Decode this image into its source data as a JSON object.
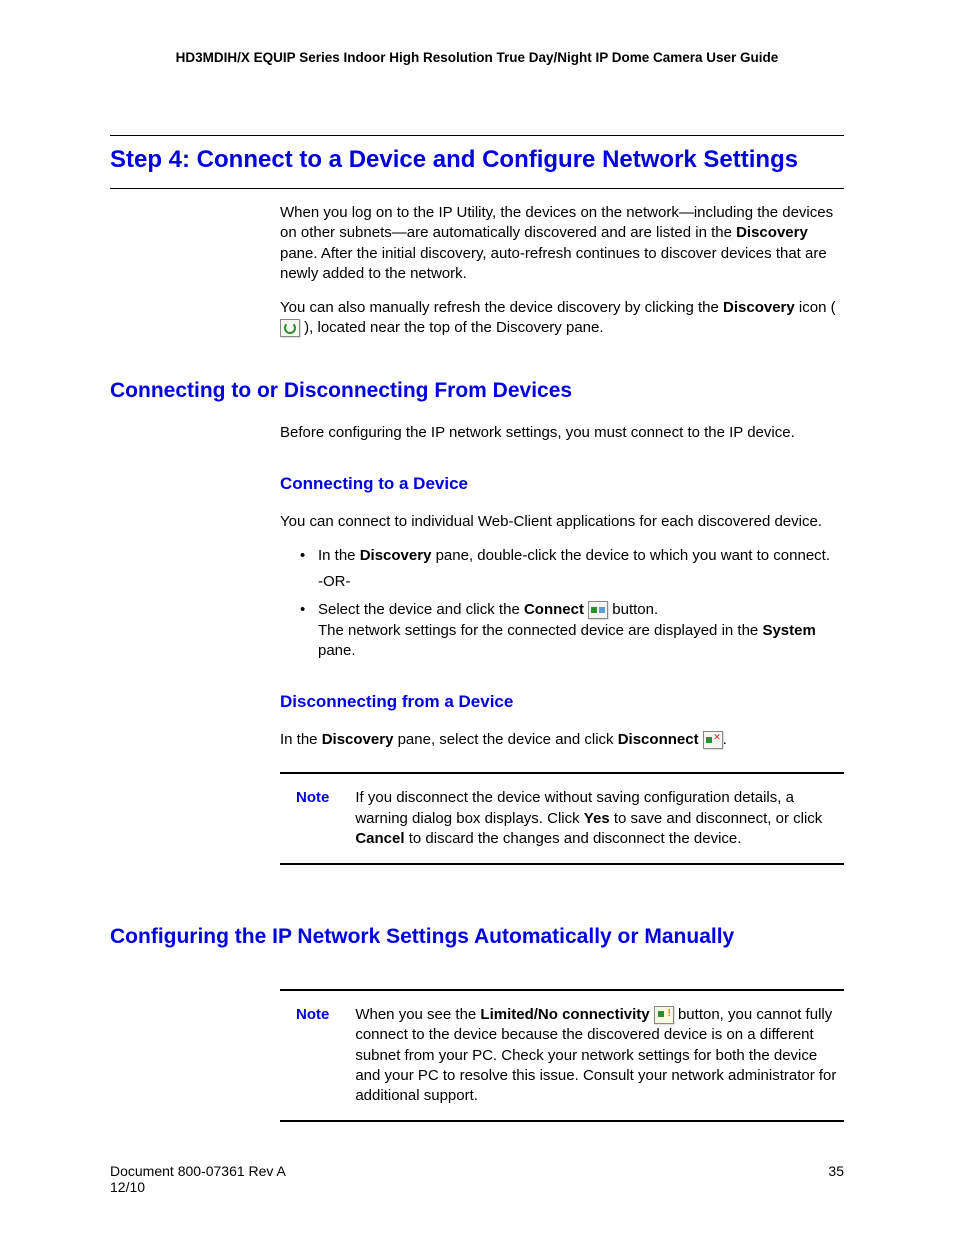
{
  "header": "HD3MDIH/X EQUIP Series Indoor High Resolution True Day/Night IP Dome Camera User Guide",
  "title": "Step 4: Connect to a Device and Configure Network Settings",
  "intro": {
    "p1_a": "When you log on to the IP Utility, the devices on the network—including the devices on other subnets—are automatically discovered and are listed in the ",
    "p1_b_bold": "Discovery",
    "p1_c": " pane. After the initial discovery, auto-refresh continues to discover devices that are newly added to the network.",
    "p2_a": "You can also manually refresh the device discovery by clicking the ",
    "p2_b_bold": "Discovery",
    "p2_c": " icon ( ",
    "p2_d": " ), located near the top of the Discovery pane."
  },
  "section_connect": {
    "heading": "Connecting to or Disconnecting From Devices",
    "lead": "Before configuring the IP network settings, you must connect to the IP device.",
    "sub_connect": {
      "heading": "Connecting to a Device",
      "lead": "You can connect to individual Web-Client applications for each discovered device.",
      "bullet1_a": "In the ",
      "bullet1_b_bold": "Discovery",
      "bullet1_c": " pane, double-click the device to which you want to connect.",
      "or": "-OR-",
      "bullet2_a": "Select the device and click the ",
      "bullet2_b_bold": "Connect",
      "bullet2_c": " ",
      "bullet2_d": " button.",
      "bullet2_line2_a": "The network settings for the connected device are displayed in the ",
      "bullet2_line2_b_bold": "System",
      "bullet2_line2_c": " pane."
    },
    "sub_disconnect": {
      "heading": "Disconnecting from a Device",
      "p_a": "In the ",
      "p_b_bold": "Discovery",
      "p_c": " pane, select the device and click ",
      "p_d_bold": "Disconnect",
      "p_e": " ",
      "p_f": "."
    },
    "note1": {
      "label": "Note",
      "a": "If you disconnect the device without saving configuration details, a warning dialog box displays. Click ",
      "b_bold": "Yes",
      "c": " to save and disconnect, or click ",
      "d_bold": "Cancel",
      "e": " to discard the changes and disconnect the device."
    }
  },
  "section_config": {
    "heading": "Configuring the IP Network Settings Automatically or Manually",
    "note2": {
      "label": "Note",
      "a": "When you see the ",
      "b_bold": "Limited/No connectivity",
      "c": " ",
      "d": " button, you cannot fully connect to the device because the discovered device is on a different subnet from your PC. Check your network settings for both the device and your PC to resolve this issue. Consult your network administrator for additional support."
    }
  },
  "footer": {
    "doc": "Document 800-07361 Rev A",
    "date": "12/10",
    "page": "35"
  }
}
